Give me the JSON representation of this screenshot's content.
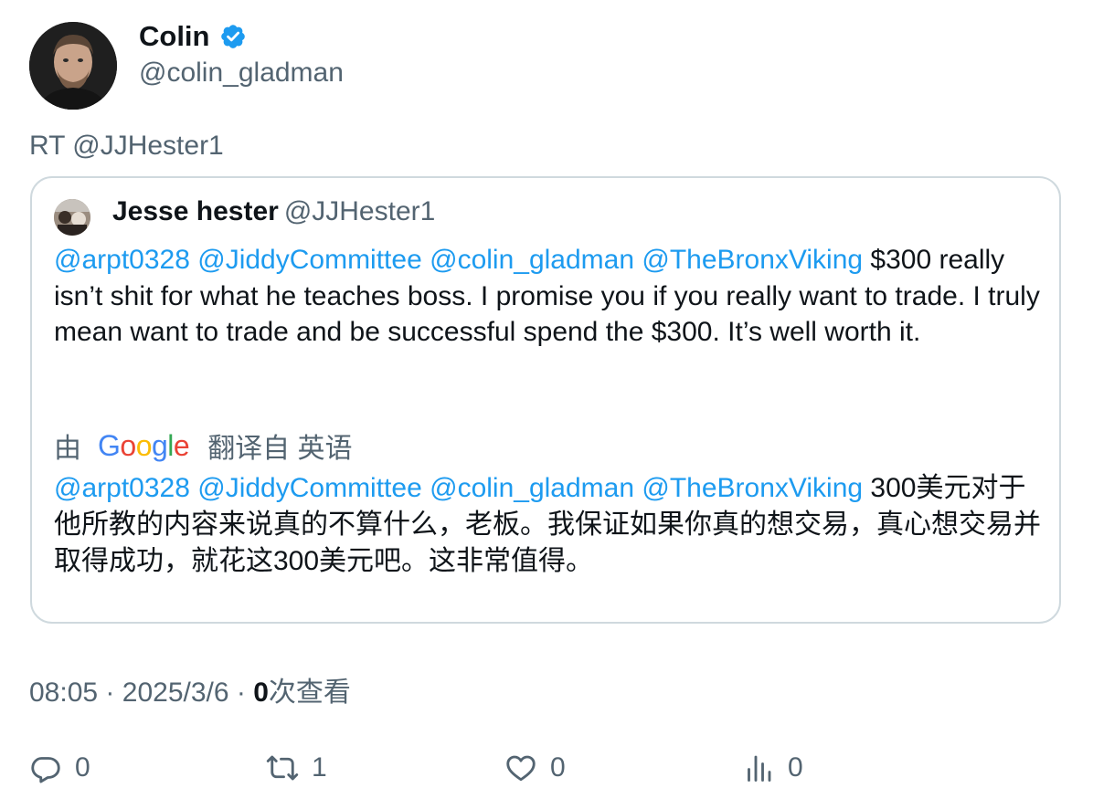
{
  "author": {
    "name": "Colin",
    "handle": "@colin_gladman",
    "verified": true
  },
  "retweet_label": "RT @JJHester1",
  "quote": {
    "name": "Jesse hester",
    "handle": "@JJHester1",
    "mentions": [
      "@arpt0328",
      "@JiddyCommittee",
      "@colin_gladman",
      "@TheBronxViking"
    ],
    "text": "$300 really isn’t shit for what he teaches boss. I promise you if you really want to trade. I truly mean want to trade and be successful spend the $300. It’s well worth it.",
    "translate_prefix": "由",
    "translate_provider": "Google",
    "translate_suffix": "翻译自 英语",
    "translated_text": "300美元对于他所教的内容来说真的不算什么，老板。我保证如果你真的想交易，真心想交易并取得成功，就花这300美元吧。这非常值得。"
  },
  "meta": {
    "time": "08:05",
    "separator": "·",
    "date": "2025/3/6",
    "views_count": "0",
    "views_label": "次查看"
  },
  "actions": {
    "reply_count": "0",
    "retweet_count": "1",
    "like_count": "0",
    "views_count": "0"
  },
  "colors": {
    "mention": "#1d9bf0",
    "verified": "#1d9bf0",
    "secondary_text": "#536471",
    "border": "#cfd9de"
  }
}
